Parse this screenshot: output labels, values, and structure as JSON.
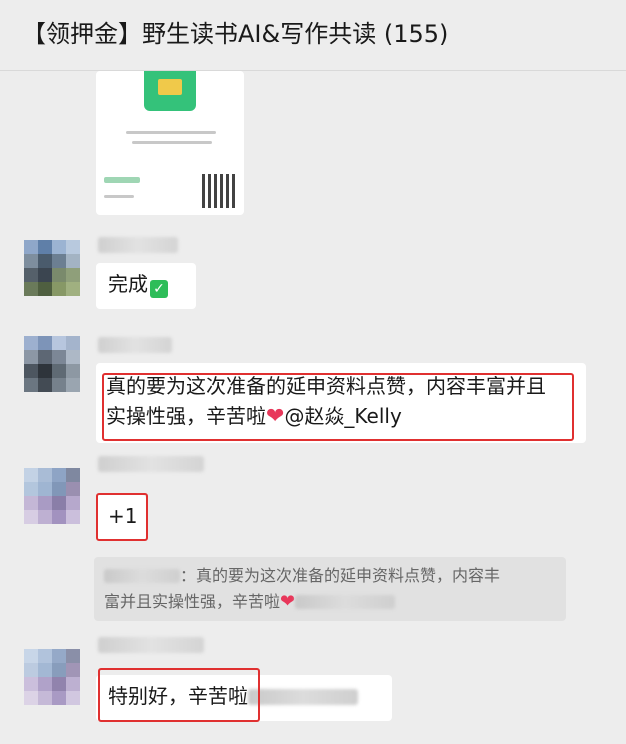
{
  "header": {
    "title": "【领押金】野生读书AI&写作共读 (155)"
  },
  "messages": {
    "m1": {
      "text": "完成"
    },
    "m2": {
      "line1": "真的要为这次准备的延申资料点赞，内容丰富并且",
      "line2_prefix": "实操性强，辛苦啦",
      "mention": "@赵焱_Kelly"
    },
    "m3": {
      "text": "+1"
    },
    "quote": {
      "line1": "：真的要为这次准备的延申资料点赞，内容丰",
      "line2": "富并且实操性强，辛苦啦"
    },
    "m4": {
      "text": "特别好，辛苦啦"
    }
  },
  "icons": {
    "check": "check-mark-icon",
    "heart": "heart-icon"
  },
  "colors": {
    "highlight": "#e03030",
    "check": "#2ebd59"
  }
}
